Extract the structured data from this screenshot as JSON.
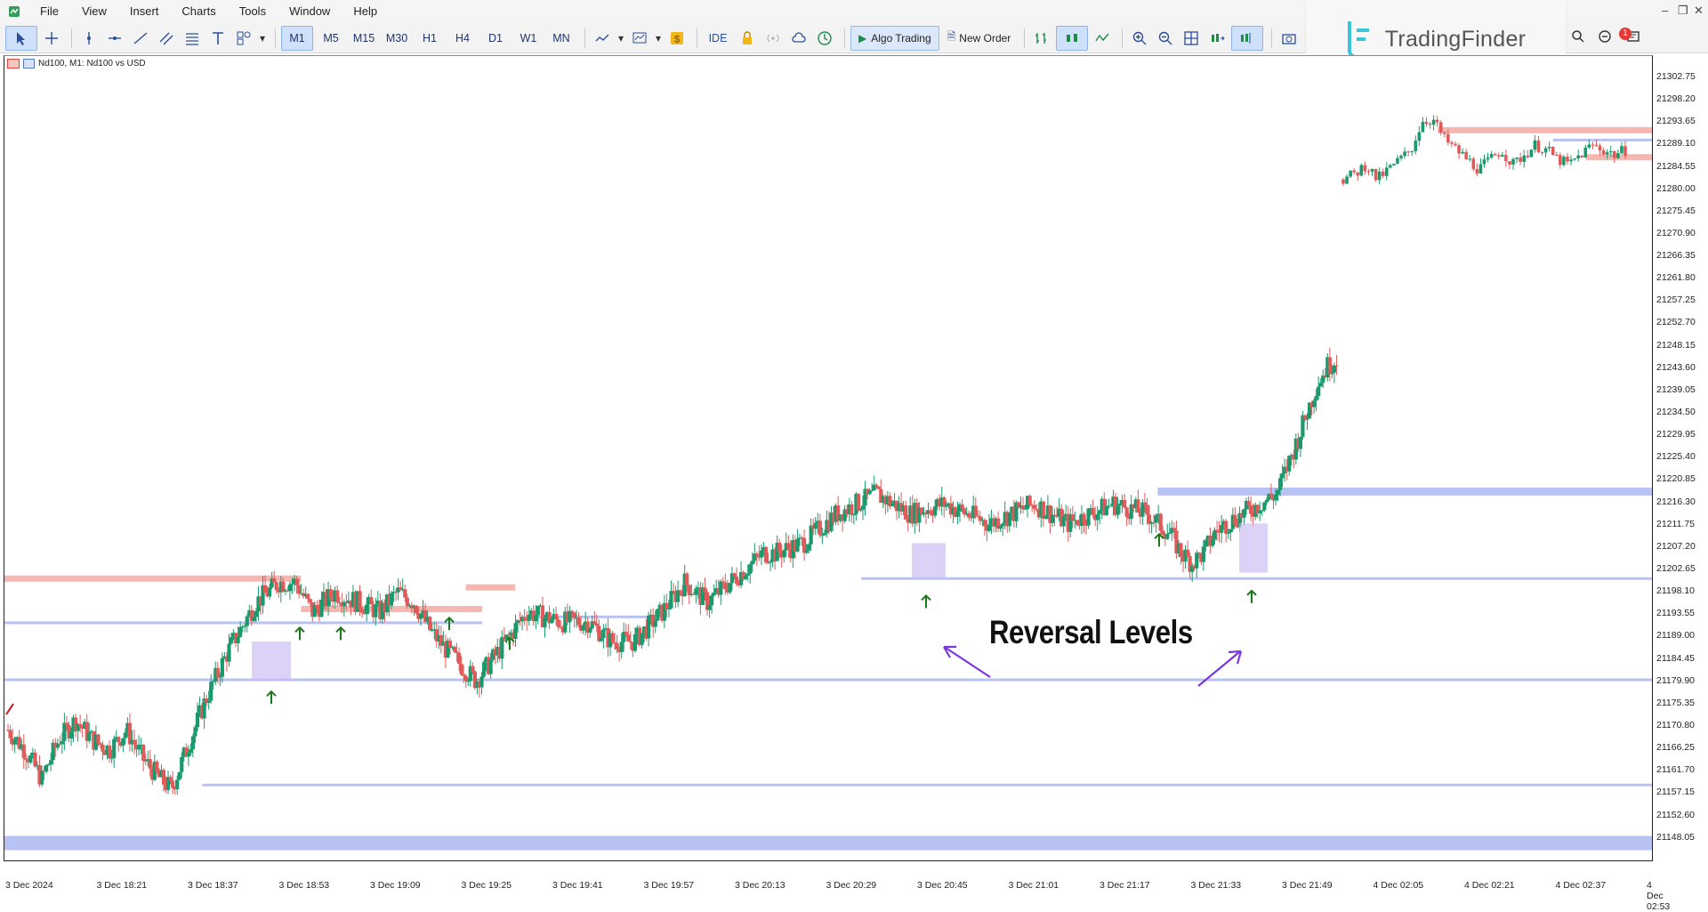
{
  "menu": {
    "items": [
      "File",
      "View",
      "Insert",
      "Charts",
      "Tools",
      "Window",
      "Help"
    ]
  },
  "toolbar": {
    "timeframes": [
      "M1",
      "M5",
      "M15",
      "M30",
      "H1",
      "H4",
      "D1",
      "W1",
      "MN"
    ],
    "active_timeframe": "M1",
    "ide_label": "IDE",
    "algo_label": "Algo Trading",
    "new_order_label": "New Order"
  },
  "logo": {
    "text": "TradingFinder"
  },
  "notifications": {
    "count": "1"
  },
  "chart": {
    "title": "Nd100, M1:  Nd100 vs USD",
    "annotation": "Reversal Levels",
    "colors": {
      "bull": "#1a9a6c",
      "bear": "#e05a5a",
      "demand": "#b9c3f3",
      "supply": "#f6b7b0",
      "arrow": "#1a7a1a",
      "annot": "#7a35e0"
    }
  },
  "chart_data": {
    "type": "candlestick",
    "symbol": "Nd100",
    "timeframe": "M1",
    "ylim": [
      21146.0,
      21306.0
    ],
    "y_ticks": [
      "21302.75",
      "21298.20",
      "21293.65",
      "21289.10",
      "21284.55",
      "21280.00",
      "21275.45",
      "21270.90",
      "21266.35",
      "21261.80",
      "21257.25",
      "21252.70",
      "21248.15",
      "21243.60",
      "21239.05",
      "21234.50",
      "21229.95",
      "21225.40",
      "21220.85",
      "21216.30",
      "21211.75",
      "21207.20",
      "21202.65",
      "21198.10",
      "21193.55",
      "21189.00",
      "21184.45",
      "21179.90",
      "21175.35",
      "21170.80",
      "21166.25",
      "21161.70",
      "21157.15",
      "21152.60",
      "21148.05"
    ],
    "x_labels": [
      "3 Dec 2024",
      "3 Dec 18:21",
      "3 Dec 18:37",
      "3 Dec 18:53",
      "3 Dec 19:09",
      "3 Dec 19:25",
      "3 Dec 19:41",
      "3 Dec 19:57",
      "3 Dec 20:13",
      "3 Dec 20:29",
      "3 Dec 20:45",
      "3 Dec 21:01",
      "3 Dec 21:17",
      "3 Dec 21:33",
      "3 Dec 21:49",
      "4 Dec 02:05",
      "4 Dec 02:21",
      "4 Dec 02:37",
      "4 Dec 02:53"
    ],
    "close_path": [
      [
        0,
        21170
      ],
      [
        6,
        21166
      ],
      [
        12,
        21160
      ],
      [
        18,
        21168
      ],
      [
        24,
        21172
      ],
      [
        30,
        21168
      ],
      [
        36,
        21166
      ],
      [
        42,
        21170
      ],
      [
        48,
        21164
      ],
      [
        54,
        21160
      ],
      [
        58,
        21158
      ],
      [
        62,
        21164
      ],
      [
        70,
        21176
      ],
      [
        78,
        21186
      ],
      [
        82,
        21190
      ],
      [
        88,
        21196
      ],
      [
        96,
        21200
      ],
      [
        102,
        21200
      ],
      [
        108,
        21194
      ],
      [
        116,
        21198
      ],
      [
        124,
        21196
      ],
      [
        132,
        21194
      ],
      [
        138,
        21198
      ],
      [
        144,
        21196
      ],
      [
        150,
        21190
      ],
      [
        156,
        21186
      ],
      [
        166,
        21180
      ],
      [
        174,
        21186
      ],
      [
        184,
        21194
      ],
      [
        196,
        21192
      ],
      [
        206,
        21192
      ],
      [
        214,
        21188
      ],
      [
        222,
        21188
      ],
      [
        232,
        21194
      ],
      [
        240,
        21200
      ],
      [
        248,
        21196
      ],
      [
        252,
        21198
      ],
      [
        264,
        21204
      ],
      [
        268,
        21206
      ],
      [
        272,
        21206
      ],
      [
        282,
        21208
      ],
      [
        294,
        21214
      ],
      [
        308,
        21218
      ],
      [
        320,
        21214
      ],
      [
        332,
        21216
      ],
      [
        348,
        21212
      ],
      [
        364,
        21216
      ],
      [
        376,
        21212
      ],
      [
        384,
        21214
      ],
      [
        392,
        21216
      ],
      [
        404,
        21214
      ],
      [
        412,
        21210
      ],
      [
        416,
        21206
      ],
      [
        420,
        21204
      ],
      [
        424,
        21206
      ],
      [
        428,
        21210
      ],
      [
        432,
        21212
      ],
      [
        438,
        21214
      ],
      [
        444,
        21216
      ],
      [
        450,
        21218
      ],
      [
        458,
        21230
      ],
      [
        464,
        21240
      ],
      [
        468,
        21244
      ],
      [
        472,
        21246
      ]
    ],
    "gap_candles": [
      [
        0,
        21282
      ],
      [
        10,
        21283
      ],
      [
        20,
        21285
      ],
      [
        30,
        21282
      ],
      [
        40,
        21284
      ],
      [
        50,
        21286
      ],
      [
        60,
        21288
      ],
      [
        70,
        21294
      ],
      [
        80,
        21294
      ],
      [
        90,
        21290
      ],
      [
        100,
        21288
      ],
      [
        110,
        21286
      ],
      [
        120,
        21284
      ],
      [
        130,
        21286
      ],
      [
        140,
        21288
      ],
      [
        150,
        21285
      ],
      [
        160,
        21287
      ],
      [
        170,
        21289
      ],
      [
        180,
        21288
      ],
      [
        190,
        21286
      ],
      [
        200,
        21285
      ],
      [
        210,
        21287
      ],
      [
        220,
        21289
      ],
      [
        230,
        21288
      ],
      [
        240,
        21287
      ],
      [
        250,
        21288
      ]
    ],
    "reversal_levels": [
      {
        "kind": "demand",
        "price": 21147.0,
        "x_from": 0,
        "x_to": 1.0
      },
      {
        "kind": "demand",
        "price": 21158.8,
        "x_from": 0.12,
        "x_to": 1.0
      },
      {
        "kind": "demand",
        "price": 21180.2,
        "x_from": 0,
        "x_to": 1.0
      },
      {
        "kind": "demand",
        "price": 21191.8,
        "x_from": 0,
        "x_to": 0.29
      },
      {
        "kind": "demand",
        "price": 21193.0,
        "x_from": 0.32,
        "x_to": 0.39
      },
      {
        "kind": "demand",
        "price": 21200.8,
        "x_from": 0.52,
        "x_to": 1.0
      },
      {
        "kind": "demand",
        "price": 21218.5,
        "x_from": 0.7,
        "x_to": 1.0
      },
      {
        "kind": "demand",
        "price": 21290.0,
        "x_from": 0.94,
        "x_to": 1.0
      },
      {
        "kind": "supply",
        "price": 21200.8,
        "x_from": 0,
        "x_to": 0.18
      },
      {
        "kind": "supply",
        "price": 21194.6,
        "x_from": 0.18,
        "x_to": 0.29
      },
      {
        "kind": "supply",
        "price": 21199.0,
        "x_from": 0.28,
        "x_to": 0.31
      },
      {
        "kind": "supply",
        "price": 21292.0,
        "x_from": 0.87,
        "x_to": 1.0
      },
      {
        "kind": "supply",
        "price": 21286.5,
        "x_from": 0.96,
        "x_to": 1.0
      }
    ]
  }
}
